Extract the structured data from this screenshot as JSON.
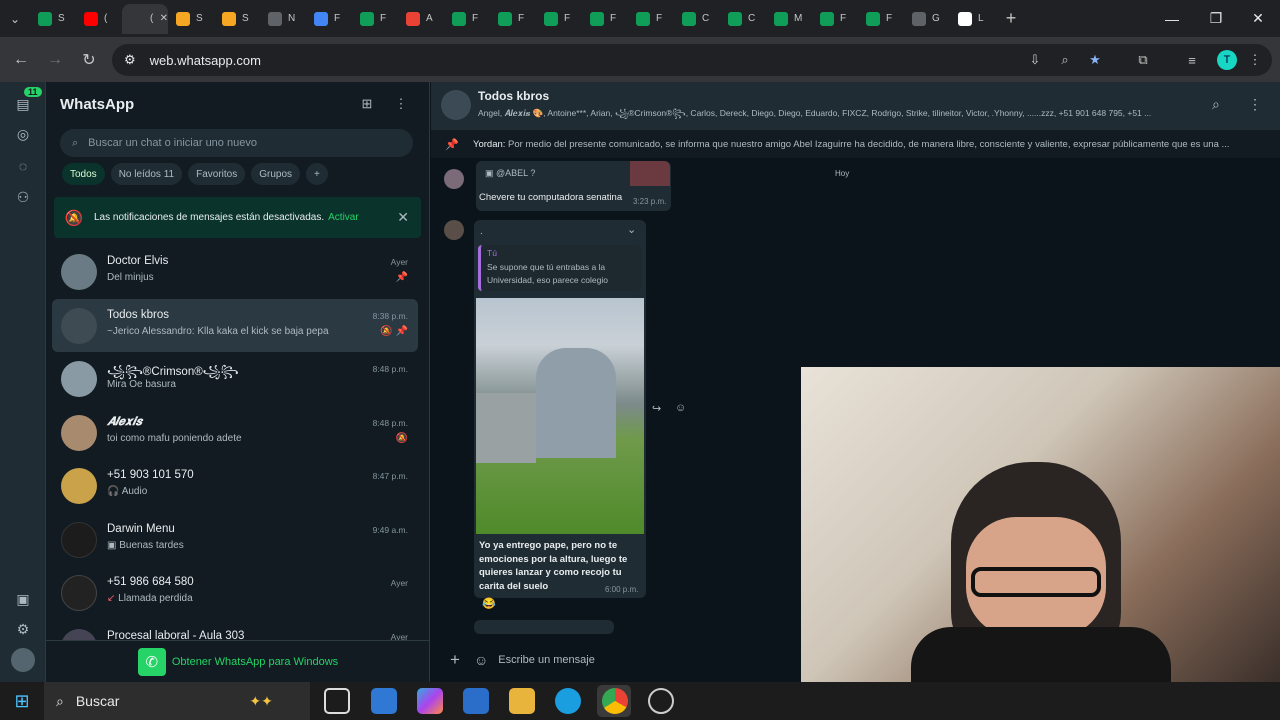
{
  "browser": {
    "tab_labels": [
      "S",
      "(",
      "(",
      "S",
      "S",
      "N",
      "F",
      "F",
      "A",
      "F",
      "F",
      "F",
      "F",
      "F",
      "C",
      "C",
      "M",
      "F",
      "F",
      "G",
      "L"
    ],
    "url": "web.whatsapp.com",
    "profile_initial": "T",
    "colors": {
      "tab_active": "#35363a",
      "frame": "#202124"
    }
  },
  "rail": {
    "chats_badge": "11"
  },
  "whatsapp": {
    "title": "WhatsApp",
    "search_placeholder": "Buscar un chat o iniciar uno nuevo",
    "filters": [
      "Todos",
      "No leídos 11",
      "Favoritos",
      "Grupos"
    ],
    "notification": {
      "text": "Las notificaciones de mensajes están desactivadas.",
      "action": "Activar"
    },
    "chats": [
      {
        "name": "Doctor Elvis",
        "msg": "Del minjus",
        "time": "Ayer"
      },
      {
        "name": "Todos kbros",
        "msg": "~Jerico Alessandro: Klla kaka el kick se baja pepa",
        "time": "8:38 p.m."
      },
      {
        "name": "꧁꧂®Crimson®꧁꧂",
        "msg": "Mira Oe basura",
        "time": "8:48 p.m."
      },
      {
        "name": "𝑨𝒍𝒆𝒙𝒊𝒔",
        "msg": "toi como mafu poniendo adete",
        "time": "8:48 p.m."
      },
      {
        "name": "+51 903 101 570",
        "msg": "Audio",
        "time": "8:47 p.m."
      },
      {
        "name": "Darwin Menu",
        "msg": "Buenas tardes",
        "time": "9:49 a.m."
      },
      {
        "name": "+51 986 684 580",
        "msg": "Llamada perdida",
        "time": "Ayer"
      },
      {
        "name": "Procesal laboral - Aula 303",
        "msg": "",
        "time": "Ayer"
      }
    ],
    "get_app": "Obtener WhatsApp para Windows",
    "colors": {
      "accent": "#25d366",
      "panel": "#111b21",
      "header": "#202c33"
    }
  },
  "conversation": {
    "title": "Todos kbros",
    "members": "Angel, 𝑨𝒍𝒆𝒙𝒊𝒔 🎨, Antoine***, Arian, ꧁®Crimson®꧂, Carlos, Dereck, Diego, Diego, Eduardo, FIXCZ, Rodrigo, Strike, tilineitor, Victor, .Yhonny, ......zzz, +51 901 648 795, +51 ...",
    "pinned_author": "Yordan:",
    "pinned_text": "Por medio del presente comunicado, se informa que nuestro amigo Abel Izaguirre ha decidido, de manera libre, consciente y valiente, expresar públicamente que es una ...",
    "day_label": "Hoy",
    "msg1": {
      "mention": "@ABEL ?",
      "text": "Chevere tu computadora senatina",
      "time": "3:23 p.m."
    },
    "msg2": {
      "sender": ".",
      "quote_name": "Tú",
      "quote_text": "Se supone que tú entrabas a la Universidad, eso parece colegio",
      "text": "Yo ya entrego pape, pero no te emociones por la altura, luego te quieres lanzar y como recojo tu carita del suelo",
      "time": "6:00 p.m.",
      "reaction": "😂"
    },
    "compose_placeholder": "Escribe un mensaje"
  },
  "taskbar": {
    "search_label": "Buscar"
  }
}
